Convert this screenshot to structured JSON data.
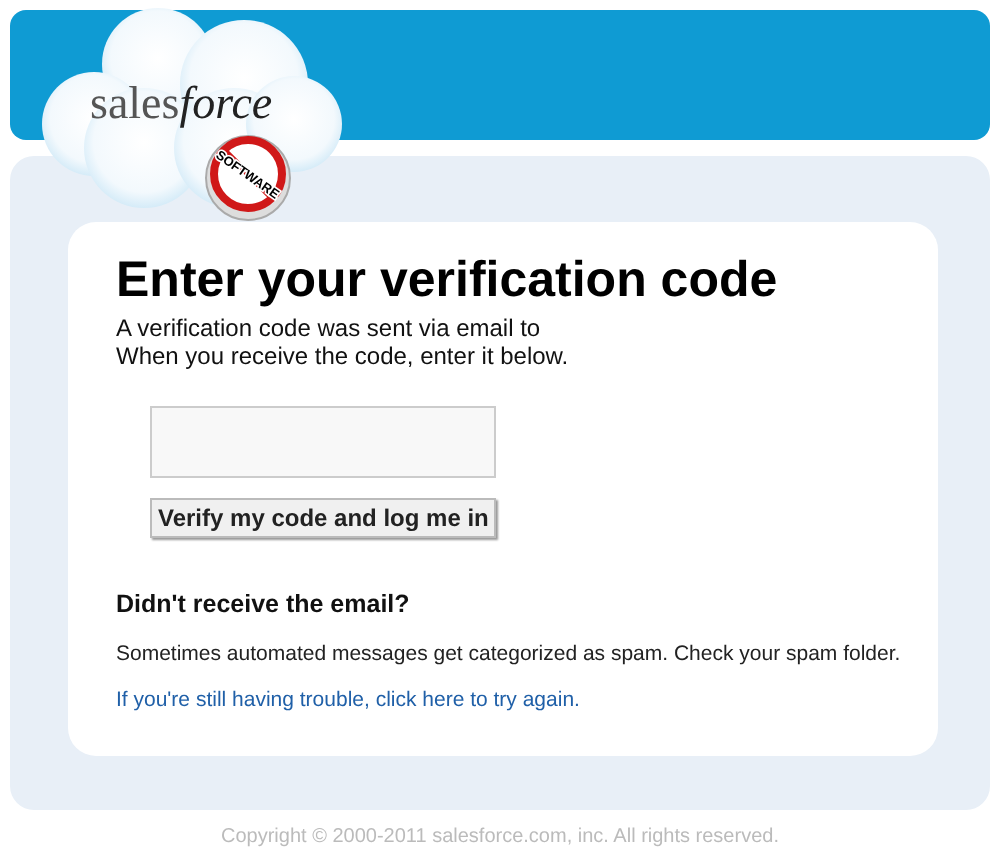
{
  "logo": {
    "wordmark_plain": "sales",
    "wordmark_italic": "force",
    "badge": "SOFTWARE"
  },
  "heading": "Enter your verification code",
  "intro": [
    "A verification code was sent via email to",
    "When you receive the code, enter it below."
  ],
  "verify_button": "Verify my code and log me in",
  "help": {
    "title": "Didn't receive the email?",
    "text": "Sometimes automated messages get categorized as spam. Check your spam folder.",
    "link": "If you're still having trouble, click here to try again."
  },
  "footer": "Copyright © 2000-2011 salesforce.com, inc. All rights reserved."
}
